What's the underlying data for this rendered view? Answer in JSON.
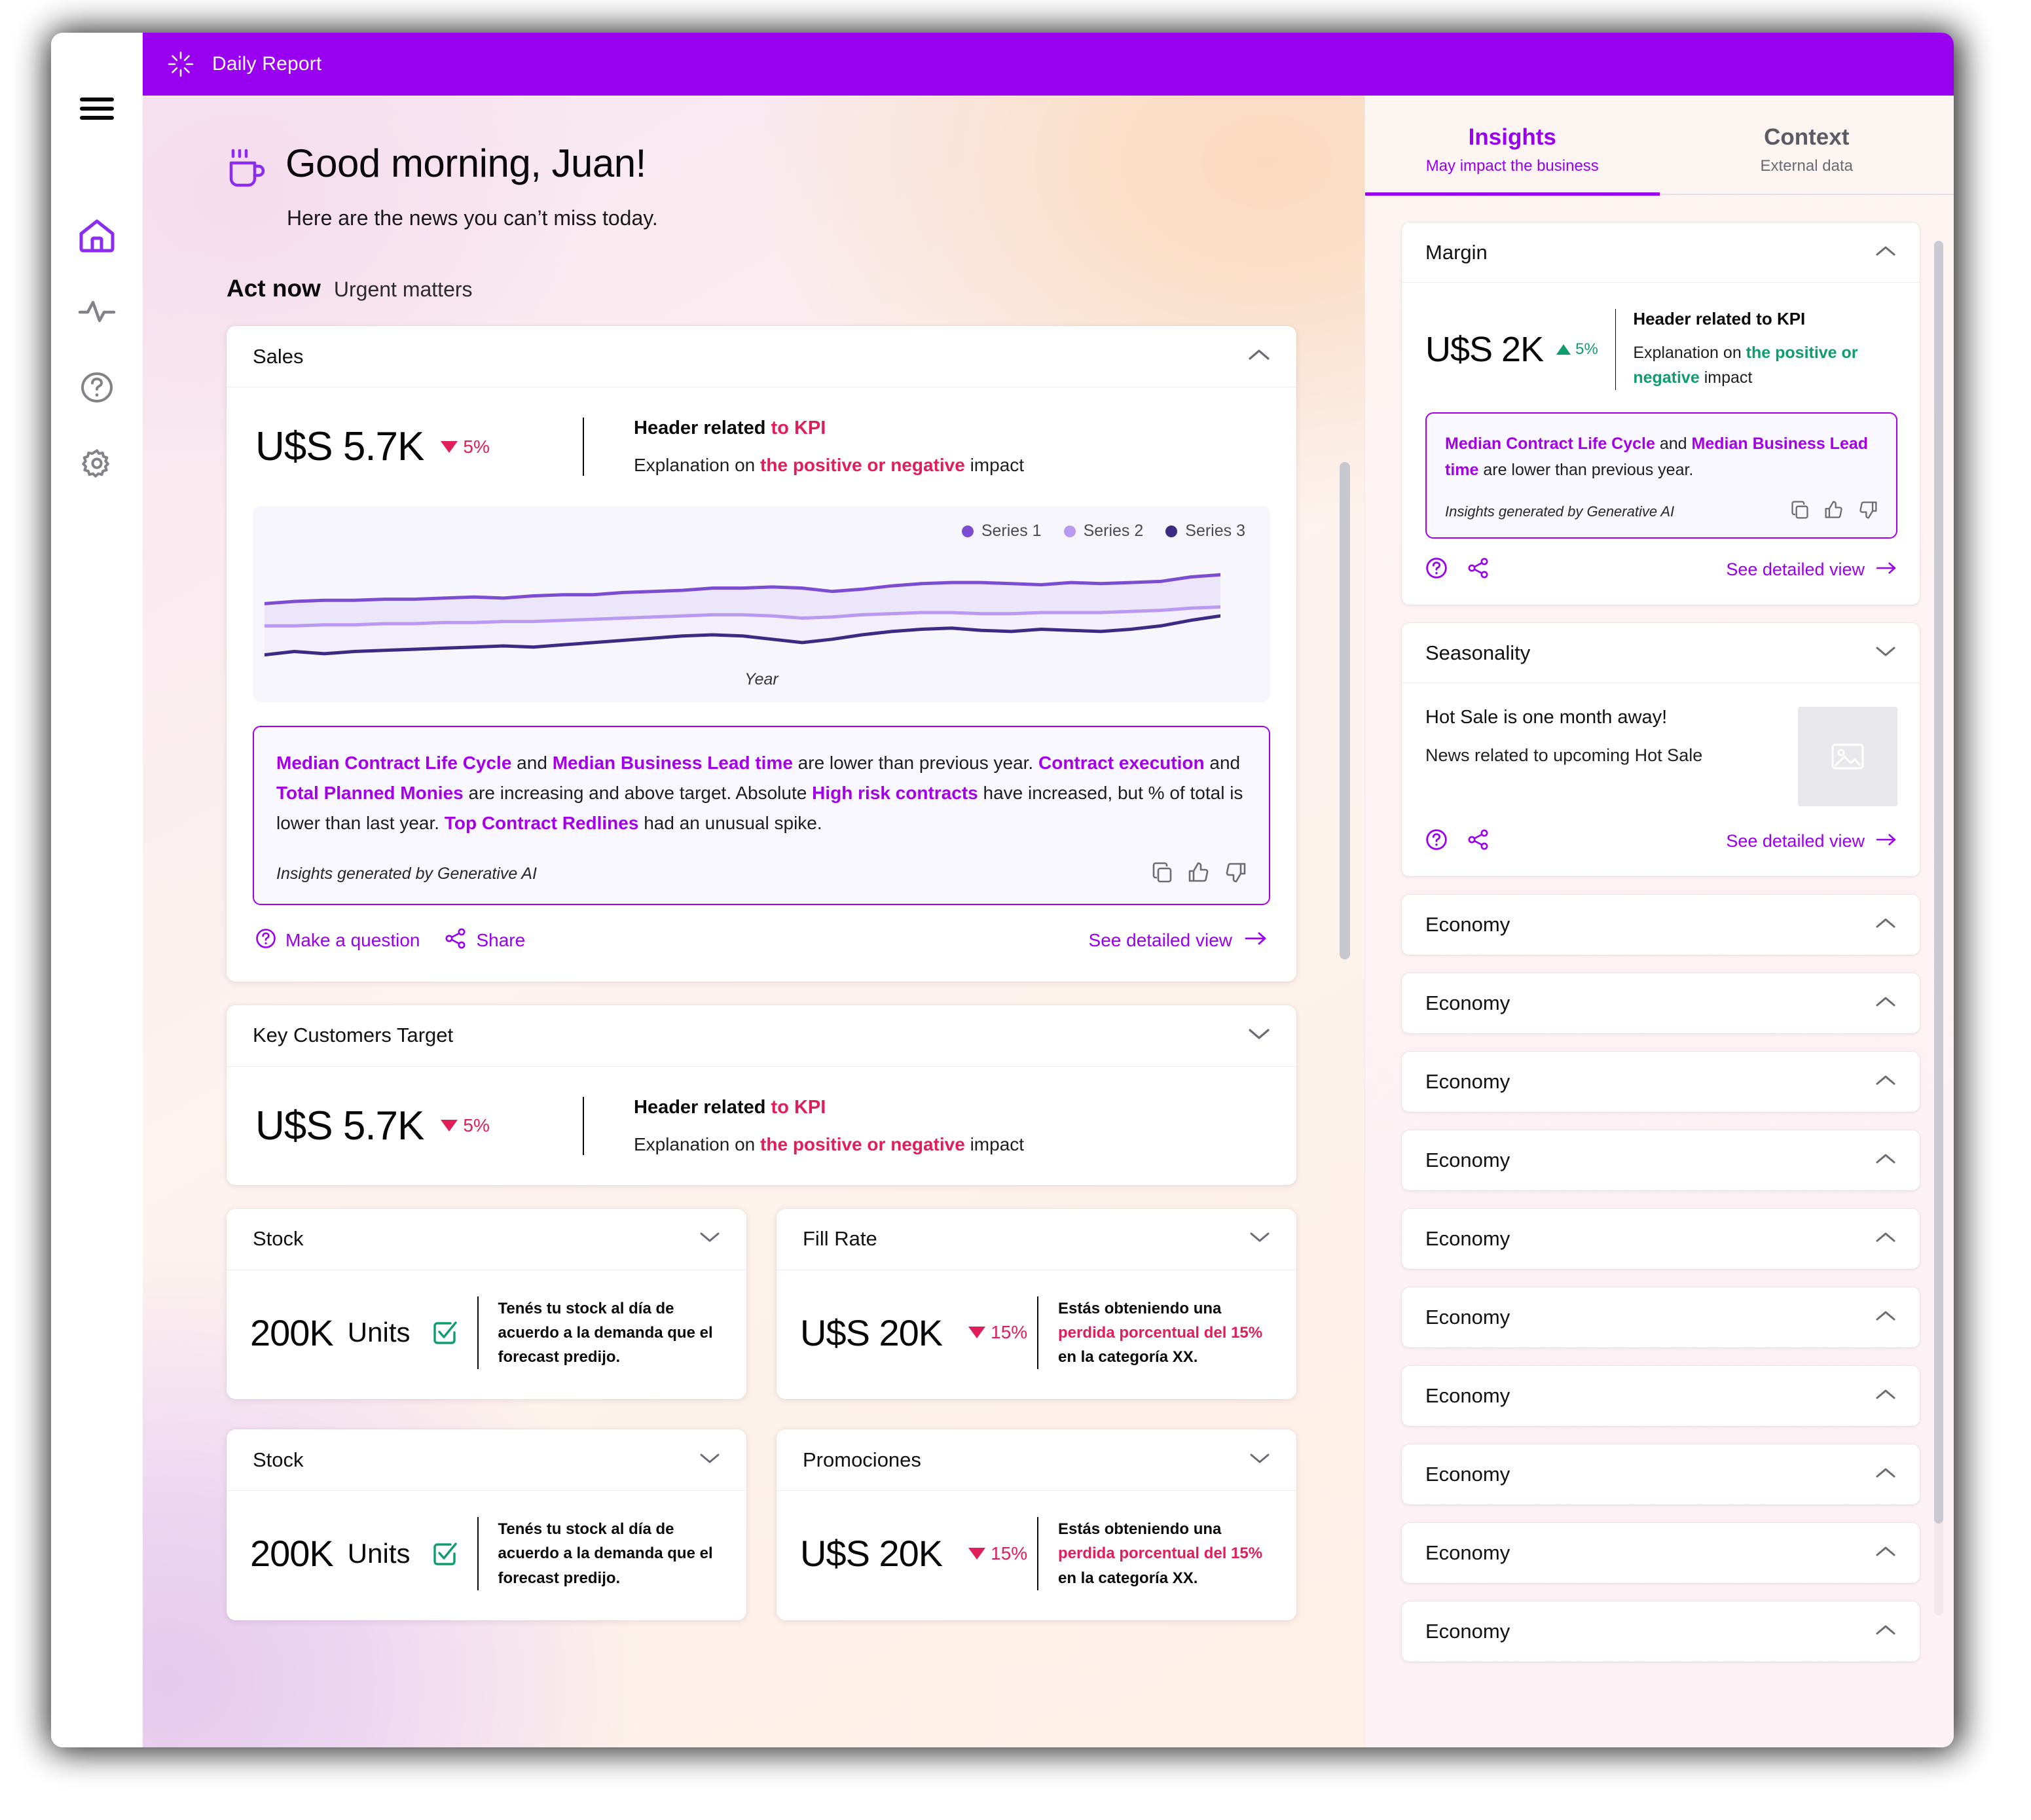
{
  "topbar": {
    "brand_icon": "sparkle-icon",
    "title": "Daily Report",
    "color": "#9900f0"
  },
  "rail": {
    "items": [
      {
        "icon": "hamburger-menu-icon",
        "name": "menu",
        "active": false
      },
      {
        "icon": "home-icon",
        "name": "home",
        "active": true
      },
      {
        "icon": "activity-pulse-icon",
        "name": "activity",
        "active": false
      },
      {
        "icon": "help-circle-icon",
        "name": "help",
        "active": false
      },
      {
        "icon": "gear-icon",
        "name": "settings",
        "active": false
      }
    ],
    "active_color": "#8b2df0"
  },
  "greeting": {
    "icon": "coffee-cup-icon",
    "title": "Good morning, Juan!",
    "subtitle": "Here are the news you can’t miss today."
  },
  "section": {
    "title": "Act now",
    "subtitle": "Urgent matters"
  },
  "colors": {
    "accent_purple": "#9900f0",
    "insight_purple": "#a400e8",
    "negative_red": "#e01e5a",
    "positive_green": "#0f9d6e"
  },
  "sales_card": {
    "title": "Sales",
    "chevron": "chevron-up-icon",
    "kpi_value": "U$S 5.7K",
    "delta": "5%",
    "delta_direction": "down",
    "header_plain": "Header related ",
    "header_accent": "to KPI",
    "exp_prefix": "Explanation on ",
    "exp_accent": "the positive or negative",
    "exp_suffix": " impact",
    "chart_xlabel": "Year",
    "insight": {
      "segments": [
        {
          "t": "Median Contract Life Cycle",
          "hl": true
        },
        {
          "t": " and ",
          "hl": false
        },
        {
          "t": "Median Business Lead time",
          "hl": true
        },
        {
          "t": " are lower than previous year. ",
          "hl": false
        },
        {
          "t": "Contract execution",
          "hl": true
        },
        {
          "t": " and ",
          "hl": false
        },
        {
          "t": "Total Planned Monies",
          "hl": true
        },
        {
          "t": " are increasing and above target. Absolute ",
          "hl": false
        },
        {
          "t": "High risk contracts",
          "hl": true
        },
        {
          "t": " have increased, but % of total is lower than last year. ",
          "hl": false
        },
        {
          "t": "Top Contract Redlines",
          "hl": true
        },
        {
          "t": " had an unusual spike.",
          "hl": false
        }
      ],
      "generated_by": "Insights generated by Generative AI",
      "actions": [
        "copy-icon",
        "thumbs-up-icon",
        "thumbs-down-icon"
      ]
    },
    "foot": {
      "question_icon": "question-circle-icon",
      "question_label": "Make a question",
      "share_icon": "share-icon",
      "share_label": "Share",
      "detail_label": "See detailed view",
      "detail_icon": "arrow-right-icon"
    }
  },
  "key_customers_card": {
    "title": "Key Customers Target",
    "chevron": "chevron-down-icon",
    "kpi_value": "U$S 5.7K",
    "delta": "5%",
    "delta_direction": "down",
    "header_plain": "Header related ",
    "header_accent": "to KPI",
    "exp_prefix": "Explanation on ",
    "exp_accent": "the positive or negative",
    "exp_suffix": " impact"
  },
  "mini_cards": [
    {
      "title": "Stock",
      "chevron": "chevron-down-icon",
      "value": "200K",
      "units": "Units",
      "status_icon": "check-square-icon",
      "status_color": "#0f9d6e",
      "text_plain": "Tenés tu stock al día de acuerdo a la demanda que el forecast predijo.",
      "text_accent": "",
      "delta": "",
      "delta_direction": ""
    },
    {
      "title": "Fill Rate",
      "chevron": "chevron-down-icon",
      "value": "U$S 20K",
      "units": "",
      "status_icon": "",
      "status_color": "",
      "text_prefix": "Estás obteniendo una ",
      "text_accent": "perdida porcentual del 15%",
      "text_suffix": " en la categoría XX.",
      "delta": "15%",
      "delta_direction": "down"
    },
    {
      "title": "Stock",
      "chevron": "chevron-down-icon",
      "value": "200K",
      "units": "Units",
      "status_icon": "check-square-icon",
      "status_color": "#0f9d6e",
      "text_plain": "Tenés tu stock al día de acuerdo a la demanda que el forecast predijo.",
      "delta": "",
      "delta_direction": ""
    },
    {
      "title": "Promociones",
      "chevron": "chevron-down-icon",
      "value": "U$S 20K",
      "units": "",
      "status_icon": "",
      "status_color": "",
      "text_prefix": "Estás obteniendo una ",
      "text_accent": "perdida porcentual del 15%",
      "text_suffix": " en la categoría XX.",
      "delta": "15%",
      "delta_direction": "down"
    }
  ],
  "right_panel": {
    "tabs": [
      {
        "label": "Insights",
        "sub": "May impact the business",
        "active": true
      },
      {
        "label": "Context",
        "sub": "External data",
        "active": false
      }
    ],
    "margin_card": {
      "title": "Margin",
      "chevron": "chevron-up-icon",
      "kpi_value": "U$S 2K",
      "delta": "5%",
      "delta_direction": "up",
      "header": "Header related to KPI",
      "exp_prefix": "Explanation on ",
      "exp_accent": "the positive or negative",
      "exp_suffix": " impact",
      "insight": {
        "segments": [
          {
            "t": "Median Contract Life Cycle",
            "hl": true
          },
          {
            "t": " and ",
            "hl": false
          },
          {
            "t": "Median Business Lead time",
            "hl": true
          },
          {
            "t": " are lower than previous year.",
            "hl": false
          }
        ],
        "generated_by": "Insights generated by Generative AI",
        "actions": [
          "copy-icon",
          "thumbs-up-icon",
          "thumbs-down-icon"
        ]
      },
      "foot": {
        "question_icon": "question-circle-icon",
        "share_icon": "share-icon",
        "detail_label": "See detailed view",
        "detail_icon": "arrow-right-icon"
      }
    },
    "seasonality_card": {
      "title": "Seasonality",
      "chevron": "chevron-down-icon",
      "headline": "Hot Sale is one month away!",
      "body": "News related to upcoming Hot Sale",
      "thumb_icon": "image-placeholder-icon",
      "foot": {
        "question_icon": "question-circle-icon",
        "share_icon": "share-icon",
        "detail_label": "See detailed view",
        "detail_icon": "arrow-right-icon"
      }
    },
    "collapsed_cards": [
      {
        "title": "Economy",
        "chevron": "chevron-up-icon"
      },
      {
        "title": "Economy",
        "chevron": "chevron-up-icon"
      },
      {
        "title": "Economy",
        "chevron": "chevron-up-icon"
      },
      {
        "title": "Economy",
        "chevron": "chevron-up-icon"
      },
      {
        "title": "Economy",
        "chevron": "chevron-up-icon"
      },
      {
        "title": "Economy",
        "chevron": "chevron-up-icon"
      },
      {
        "title": "Economy",
        "chevron": "chevron-up-icon"
      },
      {
        "title": "Economy",
        "chevron": "chevron-up-icon"
      },
      {
        "title": "Economy",
        "chevron": "chevron-up-icon"
      },
      {
        "title": "Economy",
        "chevron": "chevron-up-icon"
      }
    ]
  },
  "chart_data": {
    "type": "line",
    "title": "",
    "xlabel": "Year",
    "ylabel": "",
    "grid": false,
    "legend_position": "top-right",
    "x": [
      0,
      1,
      2,
      3,
      4,
      5,
      6,
      7,
      8,
      9,
      10,
      11,
      12,
      13,
      14,
      15,
      16,
      17,
      18,
      19,
      20,
      21,
      22,
      23,
      24,
      25,
      26,
      27,
      28,
      29,
      30,
      31,
      32
    ],
    "series": [
      {
        "name": "Series 1",
        "color": "#7c4dd1",
        "values": [
          58,
          60,
          61,
          61,
          62,
          62,
          63,
          64,
          63,
          65,
          66,
          66,
          68,
          69,
          70,
          72,
          72,
          73,
          72,
          69,
          71,
          74,
          76,
          77,
          77,
          76,
          75,
          77,
          76,
          77,
          78,
          82,
          84
        ]
      },
      {
        "name": "Series 2",
        "color": "#b99af0",
        "values": [
          38,
          38,
          39,
          39,
          40,
          40,
          41,
          41,
          42,
          42,
          43,
          44,
          45,
          46,
          47,
          48,
          48,
          47,
          45,
          46,
          48,
          49,
          50,
          50,
          49,
          49,
          50,
          50,
          50,
          51,
          52,
          54,
          55
        ]
      },
      {
        "name": "Series 3",
        "color": "#3d2b83",
        "values": [
          12,
          15,
          13,
          15,
          16,
          17,
          18,
          19,
          20,
          19,
          21,
          23,
          25,
          27,
          29,
          30,
          29,
          26,
          23,
          26,
          30,
          33,
          35,
          36,
          34,
          33,
          35,
          34,
          33,
          35,
          38,
          43,
          47
        ]
      }
    ],
    "ylim": [
      0,
      100
    ]
  }
}
